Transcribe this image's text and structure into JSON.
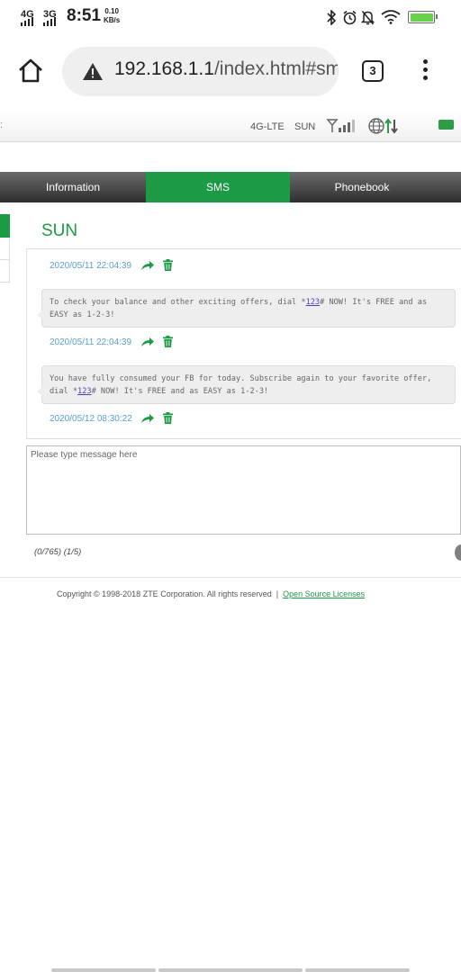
{
  "status_bar": {
    "network_1": "4G",
    "network_2": "3G",
    "time": "8:51",
    "speed_value": "0.10",
    "speed_unit": "KB/s",
    "icons": [
      "bluetooth-icon",
      "alarm-icon",
      "mute-bell-icon",
      "wifi-icon",
      "battery-icon"
    ],
    "battery_level": 1.0,
    "battery_color": "#66d14a"
  },
  "browser": {
    "url_host": "192.168.1.1",
    "url_rest": "/index.html#sms",
    "tab_count": "3",
    "icons": [
      "home-icon",
      "warning-icon",
      "tab-switcher-icon",
      "overflow-menu-icon"
    ]
  },
  "router_status": {
    "network_type": "4G-LTE",
    "carrier": "SUN",
    "icons": [
      "signal-strength-icon",
      "internet-globe-icon",
      "data-transfer-icon",
      "sms-indicator-icon"
    ]
  },
  "nav": {
    "tabs": [
      {
        "label": "Information",
        "active": false
      },
      {
        "label": "SMS",
        "active": true
      },
      {
        "label": "Phonebook",
        "active": false
      }
    ]
  },
  "conversation": {
    "contact": "SUN",
    "messages": [
      {
        "timestamp": "2020/05/11 22:04:39"
      },
      {
        "text_before": "To check your balance and other exciting offers, dial *",
        "link": "123",
        "text_after": "# NOW! It's FREE and as EASY as 1-2-3!",
        "timestamp": "2020/05/11 22:04:39"
      },
      {
        "text_before": "You have fully consumed your FB for today. Subscribe again to your favorite offer, dial *",
        "link": "123",
        "text_after": "# NOW! It's FREE and as EASY as 1-2-3!",
        "timestamp": "2020/05/12 08:30:22"
      }
    ]
  },
  "composer": {
    "placeholder": "Please type message here",
    "value": "",
    "counter": "(0/765) (1/5)"
  },
  "footer": {
    "copyright": "Copyright © 1998-2018 ZTE Corporation. All rights reserved",
    "separator": "|",
    "link": "Open Source Licenses"
  },
  "colors": {
    "accent_green": "#1c9a45",
    "timestamp_blue": "#5aa0cf",
    "nav_dark": "#3a3a3a"
  }
}
